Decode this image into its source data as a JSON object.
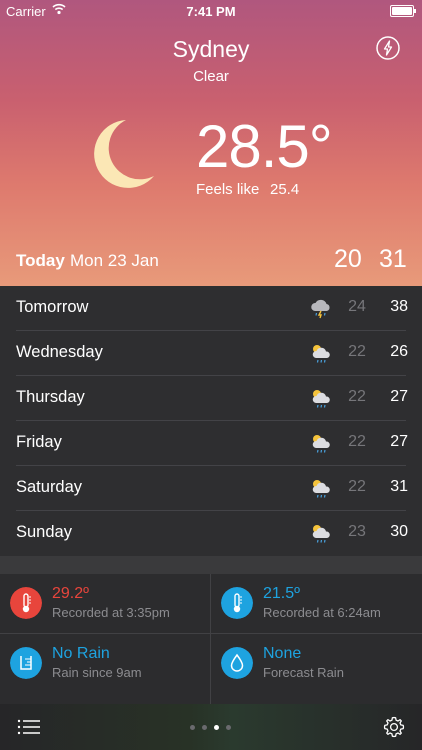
{
  "status_bar": {
    "carrier": "Carrier",
    "time": "7:41 PM"
  },
  "location": {
    "city": "Sydney",
    "condition": "Clear"
  },
  "current": {
    "temperature": "28.5°",
    "feels_like_label": "Feels like",
    "feels_like_value": "25.4"
  },
  "today": {
    "label": "Today",
    "date": "Mon 23 Jan",
    "low": "20",
    "high": "31"
  },
  "forecast": [
    {
      "day": "Tomorrow",
      "icon": "storm-cloud-icon",
      "low": "24",
      "high": "38"
    },
    {
      "day": "Wednesday",
      "icon": "sun-rain-icon",
      "low": "22",
      "high": "26"
    },
    {
      "day": "Thursday",
      "icon": "sun-rain-icon",
      "low": "22",
      "high": "27"
    },
    {
      "day": "Friday",
      "icon": "sun-rain-icon",
      "low": "22",
      "high": "27"
    },
    {
      "day": "Saturday",
      "icon": "sun-rain-icon",
      "low": "22",
      "high": "31"
    },
    {
      "day": "Sunday",
      "icon": "sun-rain-icon",
      "low": "23",
      "high": "30"
    }
  ],
  "details": {
    "max_temp": {
      "value": "29.2º",
      "sub": "Recorded at 3:35pm",
      "icon": "thermometer-icon",
      "color": "#e8453c"
    },
    "min_temp": {
      "value": "21.5º",
      "sub": "Recorded at 6:24am",
      "icon": "thermometer-icon",
      "color": "#1ea3e0"
    },
    "rain": {
      "value": "No Rain",
      "sub": "Rain since 9am",
      "icon": "rain-gauge-icon",
      "color": "#1ea3e0"
    },
    "forecast_rain": {
      "value": "None",
      "sub": "Forecast Rain",
      "icon": "water-drop-icon",
      "color": "#1ea3e0"
    }
  },
  "pager": {
    "pages": 4,
    "current_index": 2
  },
  "colors": {
    "hero_top": "#b0577e",
    "hero_bottom": "#e89a7a",
    "moon": "#fbe7b5",
    "red": "#e8453c",
    "blue": "#1ea3e0"
  }
}
